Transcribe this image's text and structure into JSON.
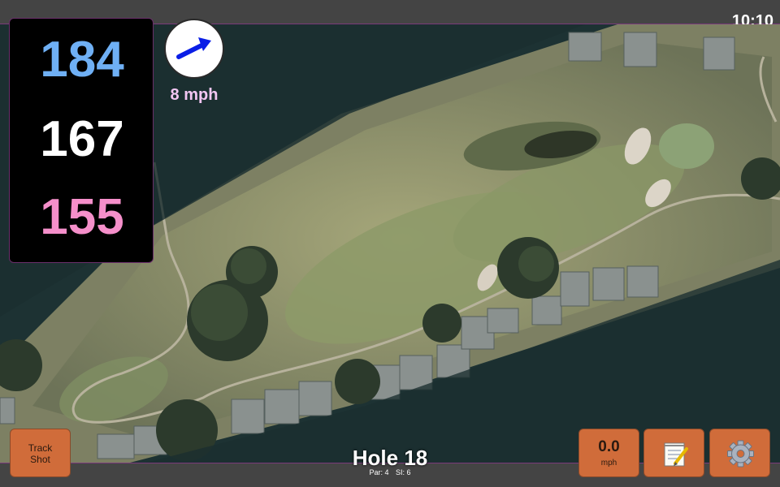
{
  "status": {
    "time": "10:10"
  },
  "distances": {
    "back": "184",
    "middle": "167",
    "front": "155"
  },
  "wind": {
    "speed_label": "8 mph",
    "direction_icon": "arrow-up-right-icon",
    "arrow_color": "#0a1ee6"
  },
  "hole": {
    "title": "Hole 18",
    "par_label": "Par: 4",
    "si_label": "SI: 6"
  },
  "buttons": {
    "track_shot": "Track\nShot",
    "track_shot_line1": "Track",
    "track_shot_line2": "Shot",
    "speed_value": "0.0",
    "speed_unit": "mph",
    "notes_icon": "notepad-icon",
    "settings_icon": "gear-icon"
  },
  "colors": {
    "button_orange": "#d06c3a",
    "back_tee": "#6fb0f5",
    "middle_tee": "#ffffff",
    "front_tee": "#f58fca",
    "wind_text": "#f2c6f2"
  }
}
